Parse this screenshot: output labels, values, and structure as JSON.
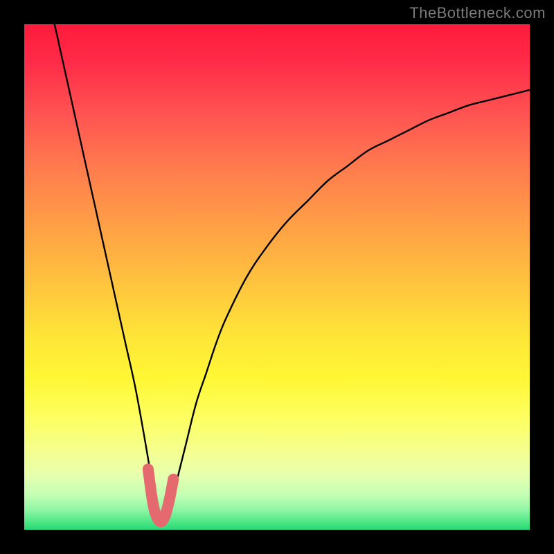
{
  "watermark": "TheBottleneck.com",
  "colors": {
    "frame": "#000000",
    "curve": "#000000",
    "highlight": "#e56a6f",
    "gradient_top": "#ff1b3b",
    "gradient_bottom": "#28d77a"
  },
  "chart_data": {
    "type": "line",
    "title": "",
    "xlabel": "",
    "ylabel": "",
    "xlim": [
      0,
      100
    ],
    "ylim": [
      0,
      100
    ],
    "grid": false,
    "legend": false,
    "annotations": [],
    "series": [
      {
        "name": "curve",
        "x": [
          6,
          8,
          10,
          12,
          14,
          16,
          18,
          20,
          22,
          24,
          25,
          26,
          27,
          28,
          29,
          30,
          32,
          34,
          36,
          38,
          40,
          44,
          48,
          52,
          56,
          60,
          64,
          68,
          72,
          76,
          80,
          84,
          88,
          92,
          96,
          100
        ],
        "y": [
          100,
          91,
          82,
          73,
          64,
          55,
          46,
          37,
          28,
          17,
          11,
          5,
          2,
          2,
          5,
          9,
          17,
          25,
          31,
          37,
          42,
          50,
          56,
          61,
          65,
          69,
          72,
          75,
          77,
          79,
          81,
          82.5,
          84,
          85,
          86,
          87
        ],
        "note": "y is bottleneck/mismatch percentage; minimum ~27 on x-axis"
      },
      {
        "name": "optimal-highlight",
        "x": [
          24.5,
          25.5,
          26.5,
          27.5,
          28.5,
          29.5
        ],
        "y": [
          12,
          5,
          2,
          2,
          5,
          10
        ],
        "note": "thick pink U-shaped marker at the valley"
      }
    ]
  }
}
